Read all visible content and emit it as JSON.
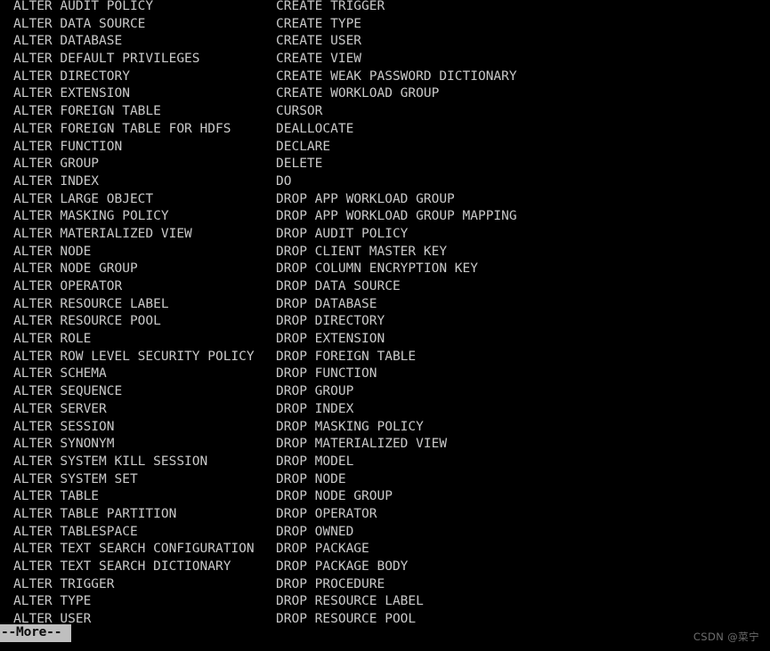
{
  "terminal": {
    "background_color": "#000000",
    "text_color": "#c9c9c9",
    "highlight_bg_color": "#bfbfbf",
    "highlight_fg_color": "#0a0a0a",
    "pager_prompt": "--More--",
    "cursor": "block-cursor"
  },
  "columns": {
    "left": [
      "ALTER AUDIT POLICY",
      "ALTER DATA SOURCE",
      "ALTER DATABASE",
      "ALTER DEFAULT PRIVILEGES",
      "ALTER DIRECTORY",
      "ALTER EXTENSION",
      "ALTER FOREIGN TABLE",
      "ALTER FOREIGN TABLE FOR HDFS",
      "ALTER FUNCTION",
      "ALTER GROUP",
      "ALTER INDEX",
      "ALTER LARGE OBJECT",
      "ALTER MASKING POLICY",
      "ALTER MATERIALIZED VIEW",
      "ALTER NODE",
      "ALTER NODE GROUP",
      "ALTER OPERATOR",
      "ALTER RESOURCE LABEL",
      "ALTER RESOURCE POOL",
      "ALTER ROLE",
      "ALTER ROW LEVEL SECURITY POLICY",
      "ALTER SCHEMA",
      "ALTER SEQUENCE",
      "ALTER SERVER",
      "ALTER SESSION",
      "ALTER SYNONYM",
      "ALTER SYSTEM KILL SESSION",
      "ALTER SYSTEM SET",
      "ALTER TABLE",
      "ALTER TABLE PARTITION",
      "ALTER TABLESPACE",
      "ALTER TEXT SEARCH CONFIGURATION",
      "ALTER TEXT SEARCH DICTIONARY",
      "ALTER TRIGGER",
      "ALTER TYPE",
      "ALTER USER"
    ],
    "right": [
      "CREATE TRIGGER",
      "CREATE TYPE",
      "CREATE USER",
      "CREATE VIEW",
      "CREATE WEAK PASSWORD DICTIONARY",
      "CREATE WORKLOAD GROUP",
      "CURSOR",
      "DEALLOCATE",
      "DECLARE",
      "DELETE",
      "DO",
      "DROP APP WORKLOAD GROUP",
      "DROP APP WORKLOAD GROUP MAPPING",
      "DROP AUDIT POLICY",
      "DROP CLIENT MASTER KEY",
      "DROP COLUMN ENCRYPTION KEY",
      "DROP DATA SOURCE",
      "DROP DATABASE",
      "DROP DIRECTORY",
      "DROP EXTENSION",
      "DROP FOREIGN TABLE",
      "DROP FUNCTION",
      "DROP GROUP",
      "DROP INDEX",
      "DROP MASKING POLICY",
      "DROP MATERIALIZED VIEW",
      "DROP MODEL",
      "DROP NODE",
      "DROP NODE GROUP",
      "DROP OPERATOR",
      "DROP OWNED",
      "DROP PACKAGE",
      "DROP PACKAGE BODY",
      "DROP PROCEDURE",
      "DROP RESOURCE LABEL",
      "DROP RESOURCE POOL"
    ]
  },
  "watermark": {
    "text": "CSDN @菜宁"
  }
}
